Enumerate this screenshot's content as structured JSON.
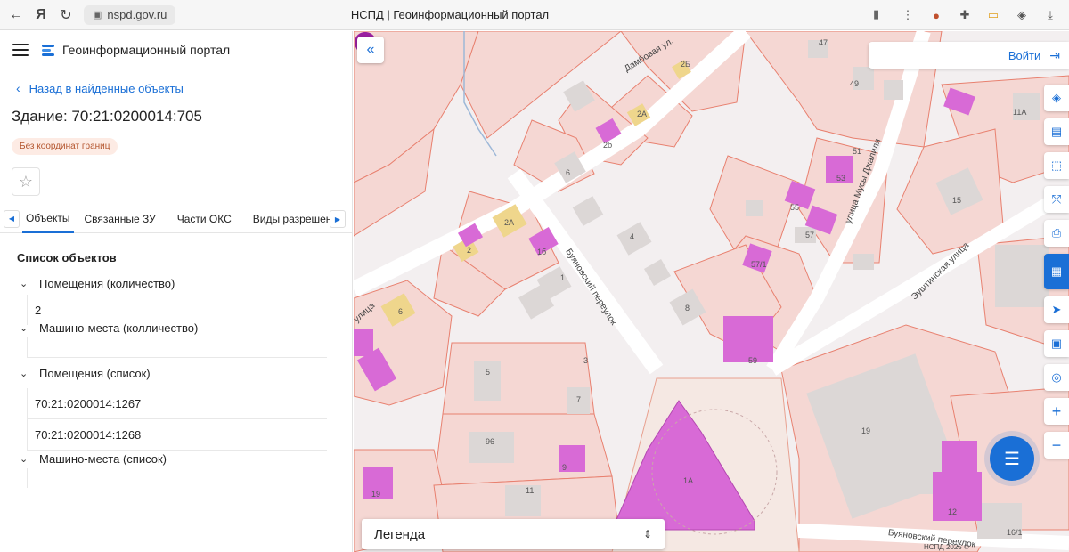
{
  "browser": {
    "url": "nspd.gov.ru",
    "tab_title": "НСПД | Геоинформационный портал"
  },
  "app": {
    "name": "Геоинформационный портал"
  },
  "panel": {
    "back_label": "Назад в найденные объекты",
    "title": "Здание: 70:21:0200014:705",
    "badge": "Без координат границ",
    "tabs": [
      "Объекты",
      "Связанные ЗУ",
      "Части ОКС",
      "Виды разрешен"
    ],
    "section_title": "Список объектов",
    "tree": {
      "rooms_count_label": "Помещения (количество)",
      "rooms_count_value": "2",
      "parking_count_label": "Машино-места (колличество)",
      "rooms_list_label": "Помещения (список)",
      "rooms_list_items": [
        "70:21:0200014:1267",
        "70:21:0200014:1268"
      ],
      "parking_list_label": "Машино-места (список)"
    }
  },
  "map": {
    "login_label": "Войти",
    "legend_label": "Легенда",
    "streets": {
      "damboaya": "Дамбовая ул.",
      "buyanovsky_lane": "Буяновский переулок",
      "dzhalil": "улица Мусы Джалиля",
      "eushtinskaya": "Эуштинская улица",
      "buyanovsky_bottom": "Буяновский переулок",
      "ulitsa": "улица",
      "nspd": "НСПД 2025 ©"
    },
    "labels": [
      "47",
      "49",
      "2б",
      "2А",
      "2Б",
      "11А",
      "51",
      "53",
      "55",
      "57",
      "15",
      "4",
      "2",
      "2А",
      "1б",
      "1",
      "6",
      "57/1",
      "8",
      "5",
      "3",
      "7",
      "96",
      "9",
      "11",
      "19",
      "1А",
      "59",
      "19",
      "12",
      "16/1",
      "6"
    ],
    "colors": {
      "parcel_fill": "#f5d7d3",
      "parcel_stroke": "#e8806f",
      "building_grey": "#dcd7d6",
      "building_magenta": "#d86ad6",
      "building_yellow": "#efd68c",
      "accent": "#1a6fd6"
    }
  }
}
